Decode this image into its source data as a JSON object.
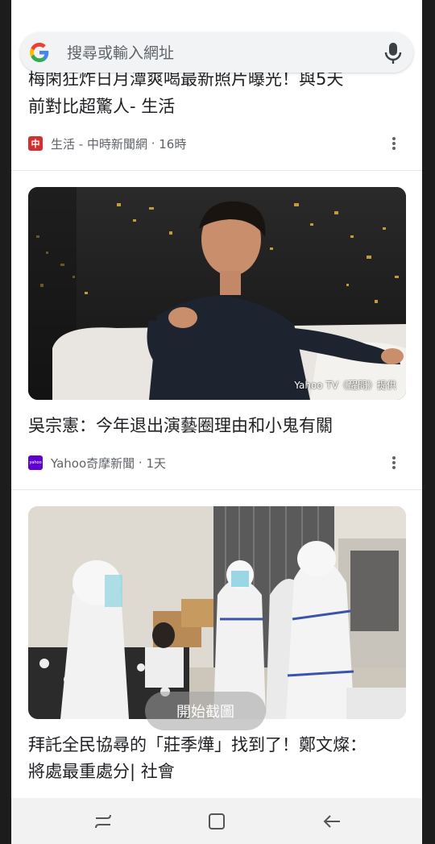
{
  "search": {
    "placeholder": "搜尋或輸入網址"
  },
  "articles": [
    {
      "title": "梅閑狂炸日月潭爽喝最新照片曝光！與5天前對比超驚人- 生活",
      "title_visible": "前對比超驚人- 生活",
      "title_top_cut": "梅閑狂炸日月潭爽喝最新照片曝光！與5天",
      "source": "生活 - 中時新聞網",
      "time": "16時",
      "source_icon": "chinatimes-icon",
      "source_icon_text": "中",
      "source_color": "#d32f2f"
    },
    {
      "title": "吳宗憲：今年退出演藝圈理由和小鬼有關",
      "source": "Yahoo奇摩新聞",
      "time": "1天",
      "source_icon": "yahoo-icon",
      "source_icon_text": "yahoo",
      "source_color": "#6001d2",
      "image_caption": "Yahoo TV《醒問》提供"
    },
    {
      "title_line1": "拜託全民協尋的「莊季燁」找到了！鄭文燦：",
      "title_line2": "將處最重處分| 社會"
    }
  ],
  "toast": {
    "text": "開始截圖"
  },
  "colors": {
    "accent": "#1a73e8",
    "page_bg": "#ffffff",
    "nav_bg": "#f2f2f2"
  }
}
